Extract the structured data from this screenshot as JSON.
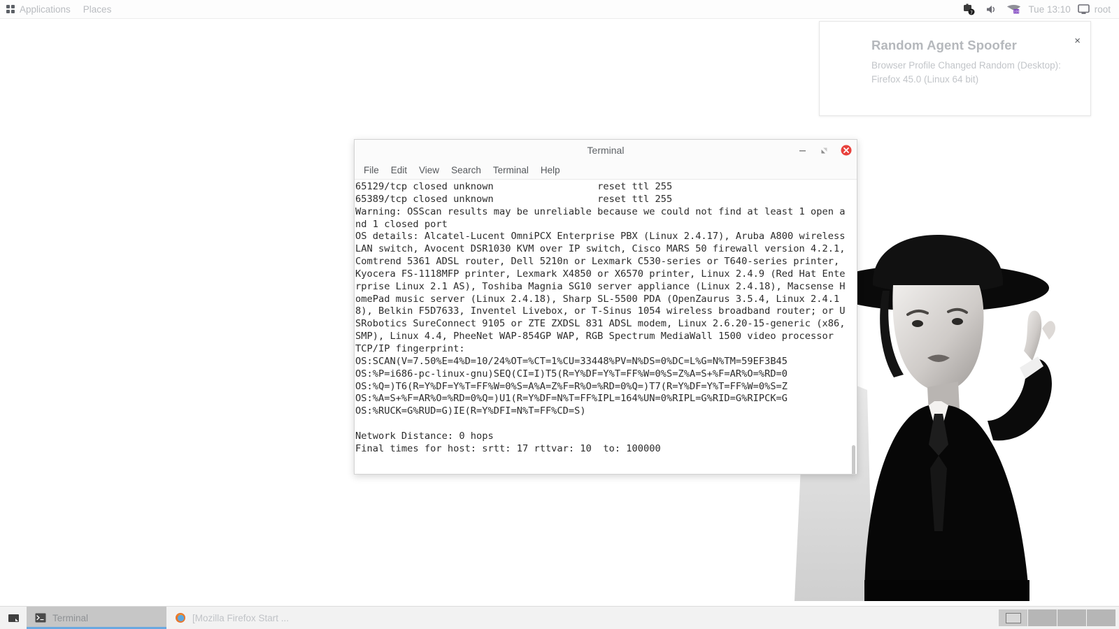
{
  "top_panel": {
    "applications_label": "Applications",
    "places_label": "Places",
    "apps_icon": "grid-icon",
    "tray": [
      {
        "name": "network-manager-icon",
        "glyph": "▣"
      },
      {
        "name": "volume-icon",
        "glyph": "🔈"
      },
      {
        "name": "battery-icon",
        "glyph": "▰"
      }
    ],
    "clock": "Tue 13:10",
    "user_label": "root",
    "user_icon": "monitor-icon"
  },
  "notification": {
    "title": "Random Agent Spoofer",
    "body": "Browser Profile Changed\nRandom (Desktop): Firefox 45.0 (Linux 64 bit)",
    "close_label": "×"
  },
  "terminal": {
    "title": "Terminal",
    "menu": [
      "File",
      "Edit",
      "View",
      "Search",
      "Terminal",
      "Help"
    ],
    "window_buttons": [
      {
        "name": "minimize-button",
        "glyph": "–"
      },
      {
        "name": "maximize-button",
        "glyph": "⤡"
      },
      {
        "name": "close-button",
        "glyph": "×"
      }
    ],
    "close_color": "#e8413c",
    "output": "65129/tcp closed unknown                  reset ttl 255\n65389/tcp closed unknown                  reset ttl 255\nWarning: OSScan results may be unreliable because we could not find at least 1 open and 1 closed port\nOS details: Alcatel-Lucent OmniPCX Enterprise PBX (Linux 2.4.17), Aruba A800 wireless LAN switch, Avocent DSR1030 KVM over IP switch, Cisco MARS 50 firewall version 4.2.1, Comtrend 5361 ADSL router, Dell 5210n or Lexmark C530-series or T640-series printer, Kyocera FS-1118MFP printer, Lexmark X4850 or X6570 printer, Linux 2.4.9 (Red Hat Enterprise Linux 2.1 AS), Toshiba Magnia SG10 server appliance (Linux 2.4.18), Macsense HomePad music server (Linux 2.4.18), Sharp SL-5500 PDA (OpenZaurus 3.5.4, Linux 2.4.18), Belkin F5D7633, Inventel Livebox, or T-Sinus 1054 wireless broadband router; or USRobotics SureConnect 9105 or ZTE ZXDSL 831 ADSL modem, Linux 2.6.20-15-generic (x86, SMP), Linux 4.4, PheeNet WAP-854GP WAP, RGB Spectrum MediaWall 1500 video processor\nTCP/IP fingerprint:\nOS:SCAN(V=7.50%E=4%D=10/24%OT=%CT=1%CU=33448%PV=N%DS=0%DC=L%G=N%TM=59EF3B45\nOS:%P=i686-pc-linux-gnu)SEQ(CI=I)T5(R=Y%DF=Y%T=FF%W=0%S=Z%A=S+%F=AR%O=%RD=0\nOS:%Q=)T6(R=Y%DF=Y%T=FF%W=0%S=A%A=Z%F=R%O=%RD=0%Q=)T7(R=Y%DF=Y%T=FF%W=0%S=Z\nOS:%A=S+%F=AR%O=%RD=0%Q=)U1(R=Y%DF=N%T=FF%IPL=164%UN=0%RIPL=G%RID=G%RIPCK=G\nOS:%RUCK=G%RUD=G)IE(R=Y%DFI=N%T=FF%CD=S)\n\nNetwork Distance: 0 hops\nFinal times for host: srtt: 17 rttvar: 10  to: 100000"
  },
  "taskbar": {
    "show_desktop_icon": "show-desktop-icon",
    "tasks": [
      {
        "label": "Terminal",
        "icon": "terminal-icon",
        "active": true
      },
      {
        "label": "[Mozilla Firefox Start ...",
        "icon": "firefox-icon",
        "active": false
      }
    ],
    "workspaces": [
      {
        "name": "workspace-1",
        "active": true
      },
      {
        "name": "workspace-2",
        "active": false
      },
      {
        "name": "workspace-3",
        "active": false
      },
      {
        "name": "workspace-4",
        "active": false
      }
    ]
  }
}
